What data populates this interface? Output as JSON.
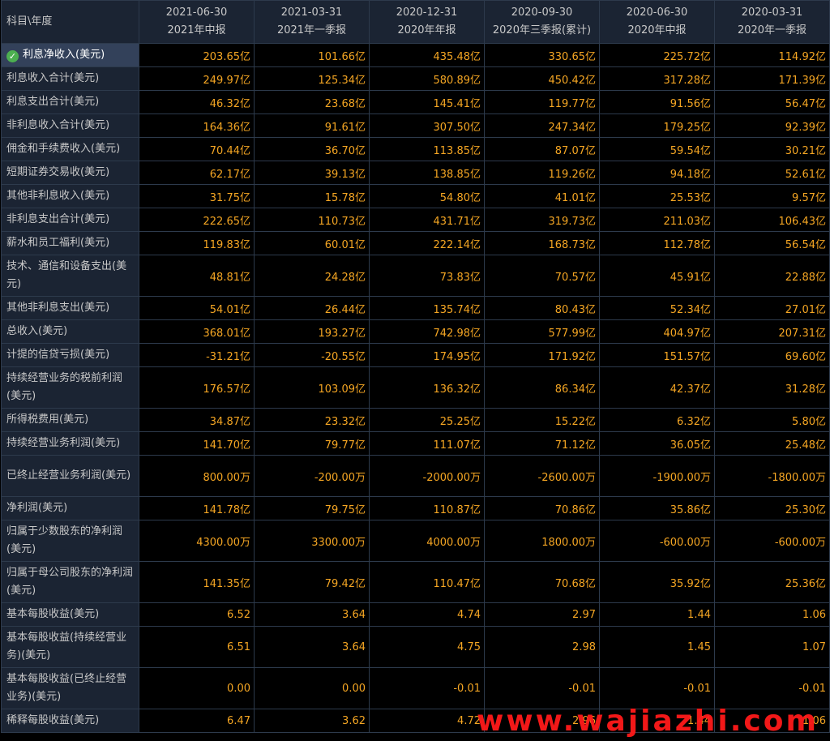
{
  "header": {
    "corner": "科目\\年度",
    "columns": [
      {
        "date": "2021-06-30",
        "period": "2021年中报"
      },
      {
        "date": "2021-03-31",
        "period": "2021年一季报"
      },
      {
        "date": "2020-12-31",
        "period": "2020年年报"
      },
      {
        "date": "2020-09-30",
        "period": "2020年三季报(累计)"
      },
      {
        "date": "2020-06-30",
        "period": "2020年中报"
      },
      {
        "date": "2020-03-31",
        "period": "2020年一季报"
      }
    ]
  },
  "rows": [
    {
      "label": "利息净收入(美元)",
      "values": [
        "203.65亿",
        "101.66亿",
        "435.48亿",
        "330.65亿",
        "225.72亿",
        "114.92亿"
      ]
    },
    {
      "label": "利息收入合计(美元)",
      "values": [
        "249.97亿",
        "125.34亿",
        "580.89亿",
        "450.42亿",
        "317.28亿",
        "171.39亿"
      ]
    },
    {
      "label": "利息支出合计(美元)",
      "values": [
        "46.32亿",
        "23.68亿",
        "145.41亿",
        "119.77亿",
        "91.56亿",
        "56.47亿"
      ]
    },
    {
      "label": "非利息收入合计(美元)",
      "values": [
        "164.36亿",
        "91.61亿",
        "307.50亿",
        "247.34亿",
        "179.25亿",
        "92.39亿"
      ]
    },
    {
      "label": "佣金和手续费收入(美元)",
      "values": [
        "70.44亿",
        "36.70亿",
        "113.85亿",
        "87.07亿",
        "59.54亿",
        "30.21亿"
      ]
    },
    {
      "label": "短期证券交易收(美元)",
      "values": [
        "62.17亿",
        "39.13亿",
        "138.85亿",
        "119.26亿",
        "94.18亿",
        "52.61亿"
      ]
    },
    {
      "label": "其他非利息收入(美元)",
      "values": [
        "31.75亿",
        "15.78亿",
        "54.80亿",
        "41.01亿",
        "25.53亿",
        "9.57亿"
      ]
    },
    {
      "label": "非利息支出合计(美元)",
      "values": [
        "222.65亿",
        "110.73亿",
        "431.71亿",
        "319.73亿",
        "211.03亿",
        "106.43亿"
      ]
    },
    {
      "label": "薪水和员工福利(美元)",
      "values": [
        "119.83亿",
        "60.01亿",
        "222.14亿",
        "168.73亿",
        "112.78亿",
        "56.54亿"
      ]
    },
    {
      "label": "技术、通信和设备支出(美元)",
      "values": [
        "48.81亿",
        "24.28亿",
        "73.83亿",
        "70.57亿",
        "45.91亿",
        "22.88亿"
      ],
      "tall": true
    },
    {
      "label": "其他非利息支出(美元)",
      "values": [
        "54.01亿",
        "26.44亿",
        "135.74亿",
        "80.43亿",
        "52.34亿",
        "27.01亿"
      ]
    },
    {
      "label": "总收入(美元)",
      "values": [
        "368.01亿",
        "193.27亿",
        "742.98亿",
        "577.99亿",
        "404.97亿",
        "207.31亿"
      ]
    },
    {
      "label": "计提的信贷亏损(美元)",
      "values": [
        "-31.21亿",
        "-20.55亿",
        "174.95亿",
        "171.92亿",
        "151.57亿",
        "69.60亿"
      ]
    },
    {
      "label": "持续经营业务的税前利润(美元)",
      "values": [
        "176.57亿",
        "103.09亿",
        "136.32亿",
        "86.34亿",
        "42.37亿",
        "31.28亿"
      ],
      "tall": true
    },
    {
      "label": "所得税费用(美元)",
      "values": [
        "34.87亿",
        "23.32亿",
        "25.25亿",
        "15.22亿",
        "6.32亿",
        "5.80亿"
      ]
    },
    {
      "label": "持续经营业务利润(美元)",
      "values": [
        "141.70亿",
        "79.77亿",
        "111.07亿",
        "71.12亿",
        "36.05亿",
        "25.48亿"
      ]
    },
    {
      "label": "已终止经营业务利润(美元)",
      "values": [
        "800.00万",
        "-200.00万",
        "-2000.00万",
        "-2600.00万",
        "-1900.00万",
        "-1800.00万"
      ],
      "tall": true
    },
    {
      "label": "净利润(美元)",
      "values": [
        "141.78亿",
        "79.75亿",
        "110.87亿",
        "70.86亿",
        "35.86亿",
        "25.30亿"
      ]
    },
    {
      "label": "归属于少数股东的净利润(美元)",
      "values": [
        "4300.00万",
        "3300.00万",
        "4000.00万",
        "1800.00万",
        "-600.00万",
        "-600.00万"
      ],
      "tall": true
    },
    {
      "label": "归属于母公司股东的净利润(美元)",
      "values": [
        "141.35亿",
        "79.42亿",
        "110.47亿",
        "70.68亿",
        "35.92亿",
        "25.36亿"
      ],
      "tall": true
    },
    {
      "label": "基本每股收益(美元)",
      "values": [
        "6.52",
        "3.64",
        "4.74",
        "2.97",
        "1.44",
        "1.06"
      ]
    },
    {
      "label": "基本每股收益(持续经营业务)(美元)",
      "values": [
        "6.51",
        "3.64",
        "4.75",
        "2.98",
        "1.45",
        "1.07"
      ],
      "tall": true
    },
    {
      "label": "基本每股收益(已终止经营业务)(美元)",
      "values": [
        "0.00",
        "0.00",
        "-0.01",
        "-0.01",
        "-0.01",
        "-0.01"
      ],
      "tall": true
    },
    {
      "label": "稀释每股收益(美元)",
      "values": [
        "6.47",
        "3.62",
        "4.72",
        "2.96",
        "1.44",
        "1.06"
      ]
    }
  ],
  "watermark": "www.wajiazhi.com",
  "colors": {
    "value": "#f5a623",
    "label": "#c8c8c8",
    "header_bg": "#1b2433",
    "selected_bg": "#33415a",
    "watermark": "#ff1a1a"
  },
  "icons": {
    "selected_row": "check-circle-icon"
  }
}
